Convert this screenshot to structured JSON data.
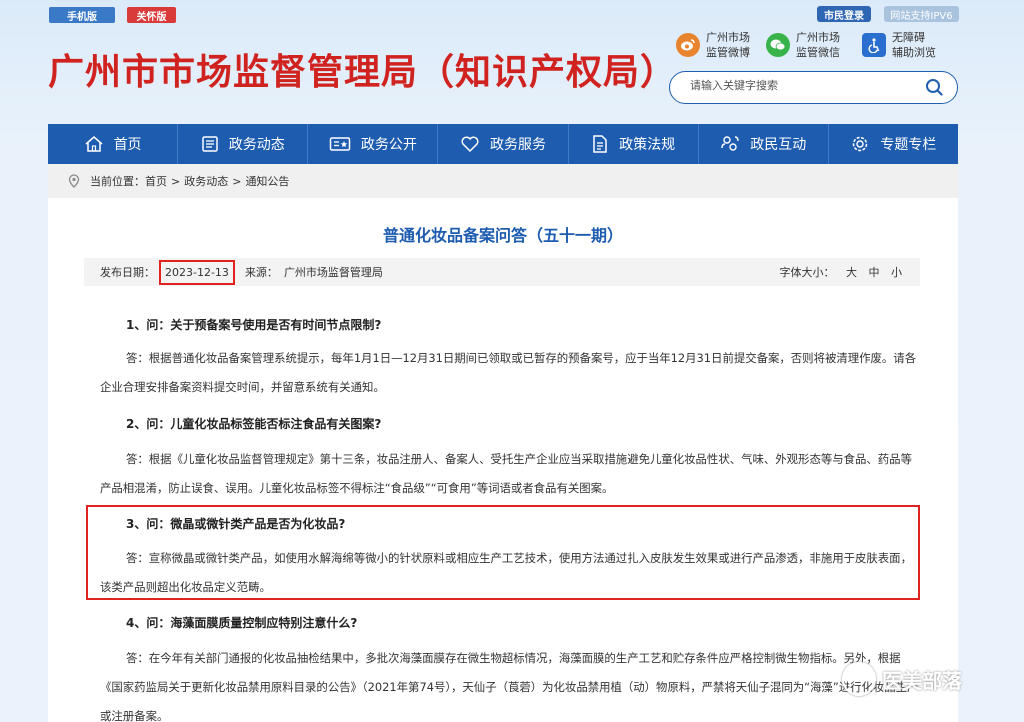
{
  "topbar": {
    "mobile_label": "手机版",
    "care_label": "关怀版",
    "login_label": "市民登录",
    "ipv6_label": "网站支持IPV6"
  },
  "header": {
    "title": "广州市市场监督管理局（知识产权局）",
    "weibo": {
      "line1": "广州市场",
      "line2": "监管微博"
    },
    "wechat": {
      "line1": "广州市场",
      "line2": "监管微信"
    },
    "accessibility": {
      "line1": "无障碍",
      "line2": "辅助浏览"
    },
    "search_placeholder": "请输入关键字搜索"
  },
  "nav": [
    {
      "label": "首页",
      "icon": "home-icon"
    },
    {
      "label": "政务动态",
      "icon": "news-icon"
    },
    {
      "label": "政务公开",
      "icon": "open-gov-icon"
    },
    {
      "label": "政务服务",
      "icon": "heart-icon"
    },
    {
      "label": "政策法规",
      "icon": "document-icon"
    },
    {
      "label": "政民互动",
      "icon": "interaction-icon"
    },
    {
      "label": "专题专栏",
      "icon": "gear-icon"
    }
  ],
  "breadcrumb": {
    "prefix": "当前位置：",
    "items": [
      "首页",
      "政务动态",
      "通知公告"
    ],
    "sep": ">"
  },
  "article": {
    "title": "普通化妆品备案问答（五十一期）",
    "date_label": "发布日期：",
    "date": "2023-12-13",
    "source_label": "来源：",
    "source": "广州市场监督管理局",
    "fontsize_label": "字体大小：",
    "fontsize_large": "大",
    "fontsize_medium": "中",
    "fontsize_small": "小",
    "q1": "1、问：关于预备案号使用是否有时间节点限制?",
    "a1": "答：根据普通化妆品备案管理系统提示，每年1月1日—12月31日期间已领取或已暂存的预备案号，应于当年12月31日前提交备案，否则将被清理作废。请各企业合理安排备案资料提交时间，并留意系统有关通知。",
    "q2": "2、问：儿童化妆品标签能否标注食品有关图案?",
    "a2": "答：根据《儿童化妆品监督管理规定》第十三条，妆品注册人、备案人、受托生产企业应当采取措施避免儿童化妆品性状、气味、外观形态等与食品、药品等产品相混淆，防止误食、误用。儿童化妆品标签不得标注“食品级”“可食用”等词语或者食品有关图案。",
    "q3": "3、问：微晶或微针类产品是否为化妆品?",
    "a3": "答：宣称微晶或微针类产品，如使用水解海绵等微小的针状原料或相应生产工艺技术，使用方法通过扎入皮肤发生效果或进行产品渗透，非施用于皮肤表面，该类产品则超出化妆品定义范畴。",
    "q4": "4、问：海藻面膜质量控制应特别注意什么?",
    "a4": "答：在今年有关部门通报的化妆品抽检结果中，多批次海藻面膜存在微生物超标情况，海藻面膜的生产工艺和贮存条件应严格控制微生物指标。另外，根据《国家药监局关于更新化妆品禁用原料目录的公告》（2021年第74号），天仙子（莨菪）为化妆品禁用植（动）物原料，严禁将天仙子混同为“海藻”进行化妆品生产或注册备案。"
  },
  "watermark": "医美部落"
}
